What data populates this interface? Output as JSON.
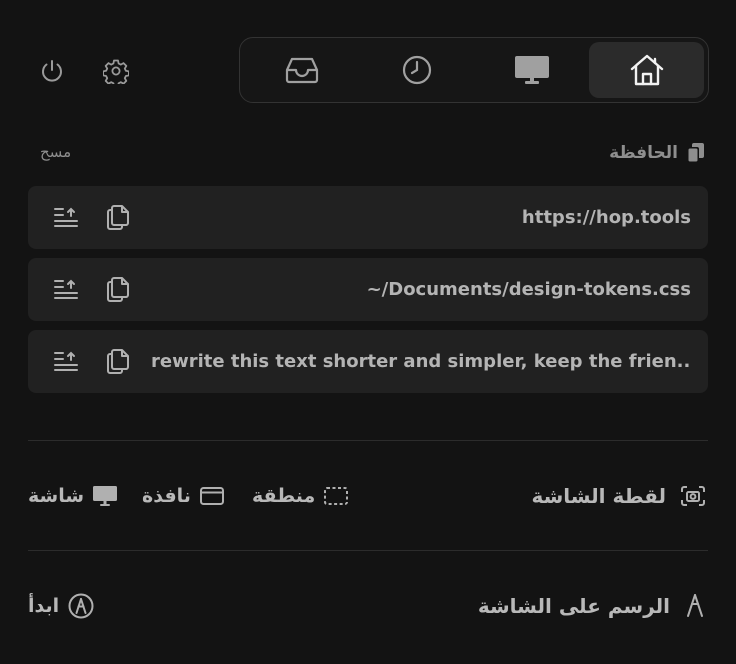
{
  "header": {
    "icons": {
      "power": "power-icon",
      "settings": "gear-icon"
    },
    "tabs": [
      {
        "name": "inbox",
        "icon": "inbox-tray-icon",
        "active": false
      },
      {
        "name": "history",
        "icon": "clock-icon",
        "active": false
      },
      {
        "name": "display",
        "icon": "monitor-icon",
        "active": false
      },
      {
        "name": "home",
        "icon": "home-icon",
        "active": true
      }
    ]
  },
  "clipboard": {
    "title": "الحافظة",
    "clear_label": "مسح",
    "items": [
      {
        "text": "https://hop.tools"
      },
      {
        "text": "~/Documents/design-tokens.css"
      },
      {
        "text": "rewrite this text shorter and simpler, keep the frien..."
      }
    ]
  },
  "screenshot": {
    "title": "لقطة الشاشة",
    "options": {
      "area": "منطقة",
      "window": "نافذة",
      "screen": "شاشة"
    }
  },
  "draw": {
    "title": "الرسم على الشاشة",
    "start_label": "ابدأ"
  },
  "colors": {
    "background": "#131313",
    "row": "#212121",
    "active_tab": "#2b2b2b",
    "text": "#b8b8b8",
    "muted": "#8e8e8e"
  }
}
